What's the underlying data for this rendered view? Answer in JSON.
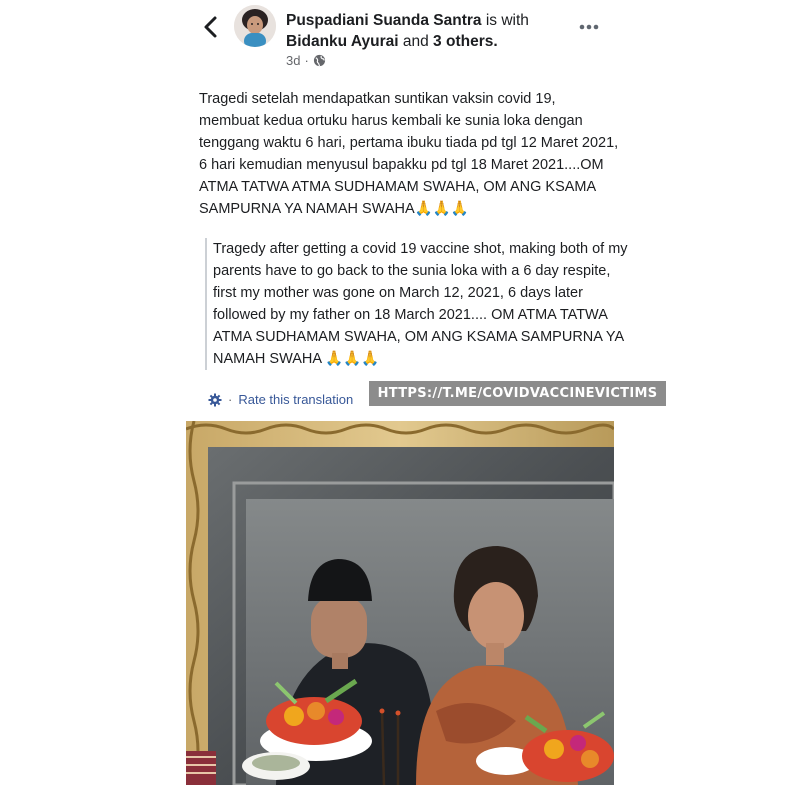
{
  "header": {
    "author": "Puspadiani Suanda Santra",
    "with_text": "is with",
    "tagged": "Bidanku Ayurai",
    "and_text": "and",
    "others": "3 others.",
    "timestamp": "3d",
    "separator": "·",
    "audience_icon": "globe-icon",
    "back_icon": "back-chevron-icon",
    "more_icon": "more-dots-icon"
  },
  "post": {
    "text": "Tragedi setelah mendapatkan suntikan vaksin covid 19, membuat kedua ortuku harus kembali ke sunia loka dengan tenggang waktu 6 hari, pertama ibuku tiada pd tgl 12 Maret 2021, 6 hari kemudian menyusul bapakku pd tgl 18 Maret 2021....OM ATMA TATWA ATMA SUDHAMAM SWAHA, OM ANG KSAMA SAMPURNA YA NAMAH SWAHA🙏🙏🙏",
    "translation": "Tragedy after getting a covid 19 vaccine shot, making both of my parents have to go back to the sunia loka with a 6 day respite, first my mother was gone on March 12, 2021, 6 days later followed by my father on 18 March 2021.... OM ATMA TATWA ATMA SUDHAMAM SWAHA, OM ANG KSAMA SAMPURNA YA NAMAH SWAHA 🙏🙏🙏",
    "rate_translation": "Rate this translation",
    "rate_separator": "·",
    "rate_icon": "gear-icon"
  },
  "watermark": "HTTPS://T.ME/COVIDVACCINEVICTIMS",
  "colors": {
    "link": "#385898",
    "meta": "#65676b",
    "text": "#1c1e21",
    "watermark_bg": "#8c8c8c",
    "frame_gold": "#b89a5a"
  }
}
